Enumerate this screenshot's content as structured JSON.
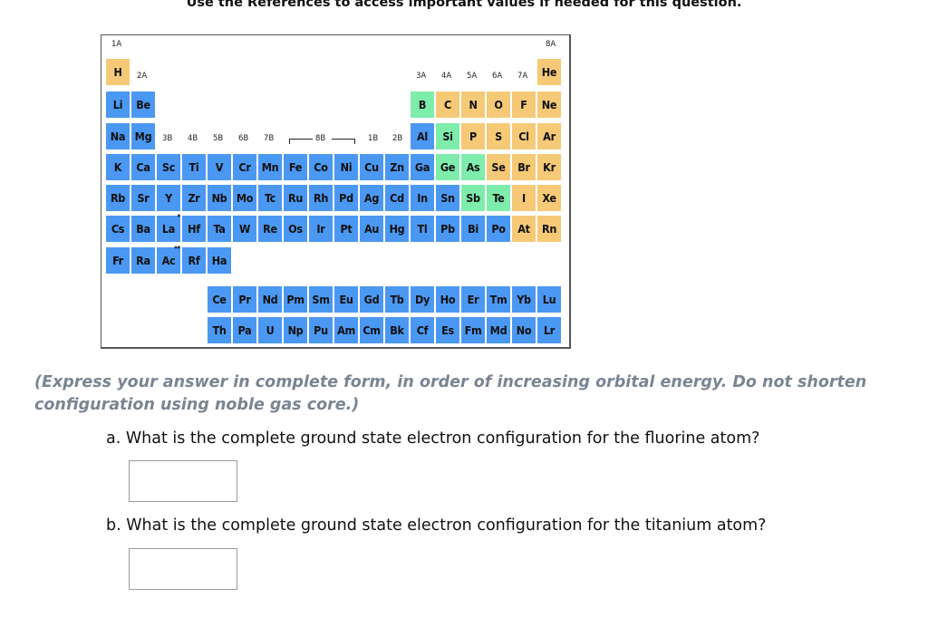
{
  "reference_note": "Use the References to access important values if needed for this question.",
  "periodic_table": {
    "group_labels": {
      "1A": "1A",
      "2A": "2A",
      "3A": "3A",
      "4A": "4A",
      "5A": "5A",
      "6A": "6A",
      "7A": "7A",
      "8A": "8A",
      "3B": "3B",
      "4B": "4B",
      "5B": "5B",
      "6B": "6B",
      "7B": "7B",
      "8B": "8B",
      "1B": "1B",
      "2B": "2B"
    },
    "colors": {
      "metal": "#4b98f2",
      "nonmetal": "#f5c976",
      "metalloid": "#7eecab"
    },
    "elements": [
      {
        "symbol": "H",
        "row": 1,
        "col": 1,
        "type": "nonmetal"
      },
      {
        "symbol": "He",
        "row": 1,
        "col": 18,
        "type": "nonmetal"
      },
      {
        "symbol": "Li",
        "row": 2,
        "col": 1,
        "type": "metal"
      },
      {
        "symbol": "Be",
        "row": 2,
        "col": 2,
        "type": "metal"
      },
      {
        "symbol": "B",
        "row": 2,
        "col": 13,
        "type": "metalloid"
      },
      {
        "symbol": "C",
        "row": 2,
        "col": 14,
        "type": "nonmetal"
      },
      {
        "symbol": "N",
        "row": 2,
        "col": 15,
        "type": "nonmetal"
      },
      {
        "symbol": "O",
        "row": 2,
        "col": 16,
        "type": "nonmetal"
      },
      {
        "symbol": "F",
        "row": 2,
        "col": 17,
        "type": "nonmetal"
      },
      {
        "symbol": "Ne",
        "row": 2,
        "col": 18,
        "type": "nonmetal"
      },
      {
        "symbol": "Na",
        "row": 3,
        "col": 1,
        "type": "metal"
      },
      {
        "symbol": "Mg",
        "row": 3,
        "col": 2,
        "type": "metal"
      },
      {
        "symbol": "Al",
        "row": 3,
        "col": 13,
        "type": "metal"
      },
      {
        "symbol": "Si",
        "row": 3,
        "col": 14,
        "type": "metalloid"
      },
      {
        "symbol": "P",
        "row": 3,
        "col": 15,
        "type": "nonmetal"
      },
      {
        "symbol": "S",
        "row": 3,
        "col": 16,
        "type": "nonmetal"
      },
      {
        "symbol": "Cl",
        "row": 3,
        "col": 17,
        "type": "nonmetal"
      },
      {
        "symbol": "Ar",
        "row": 3,
        "col": 18,
        "type": "nonmetal"
      },
      {
        "symbol": "K",
        "row": 4,
        "col": 1,
        "type": "metal"
      },
      {
        "symbol": "Ca",
        "row": 4,
        "col": 2,
        "type": "metal"
      },
      {
        "symbol": "Sc",
        "row": 4,
        "col": 3,
        "type": "metal"
      },
      {
        "symbol": "Ti",
        "row": 4,
        "col": 4,
        "type": "metal"
      },
      {
        "symbol": "V",
        "row": 4,
        "col": 5,
        "type": "metal"
      },
      {
        "symbol": "Cr",
        "row": 4,
        "col": 6,
        "type": "metal"
      },
      {
        "symbol": "Mn",
        "row": 4,
        "col": 7,
        "type": "metal"
      },
      {
        "symbol": "Fe",
        "row": 4,
        "col": 8,
        "type": "metal"
      },
      {
        "symbol": "Co",
        "row": 4,
        "col": 9,
        "type": "metal"
      },
      {
        "symbol": "Ni",
        "row": 4,
        "col": 10,
        "type": "metal"
      },
      {
        "symbol": "Cu",
        "row": 4,
        "col": 11,
        "type": "metal"
      },
      {
        "symbol": "Zn",
        "row": 4,
        "col": 12,
        "type": "metal"
      },
      {
        "symbol": "Ga",
        "row": 4,
        "col": 13,
        "type": "metal"
      },
      {
        "symbol": "Ge",
        "row": 4,
        "col": 14,
        "type": "metalloid"
      },
      {
        "symbol": "As",
        "row": 4,
        "col": 15,
        "type": "metalloid"
      },
      {
        "symbol": "Se",
        "row": 4,
        "col": 16,
        "type": "nonmetal"
      },
      {
        "symbol": "Br",
        "row": 4,
        "col": 17,
        "type": "nonmetal"
      },
      {
        "symbol": "Kr",
        "row": 4,
        "col": 18,
        "type": "nonmetal"
      },
      {
        "symbol": "Rb",
        "row": 5,
        "col": 1,
        "type": "metal"
      },
      {
        "symbol": "Sr",
        "row": 5,
        "col": 2,
        "type": "metal"
      },
      {
        "symbol": "Y",
        "row": 5,
        "col": 3,
        "type": "metal"
      },
      {
        "symbol": "Zr",
        "row": 5,
        "col": 4,
        "type": "metal"
      },
      {
        "symbol": "Nb",
        "row": 5,
        "col": 5,
        "type": "metal"
      },
      {
        "symbol": "Mo",
        "row": 5,
        "col": 6,
        "type": "metal"
      },
      {
        "symbol": "Tc",
        "row": 5,
        "col": 7,
        "type": "metal"
      },
      {
        "symbol": "Ru",
        "row": 5,
        "col": 8,
        "type": "metal"
      },
      {
        "symbol": "Rh",
        "row": 5,
        "col": 9,
        "type": "metal"
      },
      {
        "symbol": "Pd",
        "row": 5,
        "col": 10,
        "type": "metal"
      },
      {
        "symbol": "Ag",
        "row": 5,
        "col": 11,
        "type": "metal"
      },
      {
        "symbol": "Cd",
        "row": 5,
        "col": 12,
        "type": "metal"
      },
      {
        "symbol": "In",
        "row": 5,
        "col": 13,
        "type": "metal"
      },
      {
        "symbol": "Sn",
        "row": 5,
        "col": 14,
        "type": "metal"
      },
      {
        "symbol": "Sb",
        "row": 5,
        "col": 15,
        "type": "metalloid"
      },
      {
        "symbol": "Te",
        "row": 5,
        "col": 16,
        "type": "metalloid"
      },
      {
        "symbol": "I",
        "row": 5,
        "col": 17,
        "type": "nonmetal"
      },
      {
        "symbol": "Xe",
        "row": 5,
        "col": 18,
        "type": "nonmetal"
      },
      {
        "symbol": "Cs",
        "row": 6,
        "col": 1,
        "type": "metal"
      },
      {
        "symbol": "Ba",
        "row": 6,
        "col": 2,
        "type": "metal"
      },
      {
        "symbol": "La",
        "row": 6,
        "col": 3,
        "type": "metal",
        "mark": "*"
      },
      {
        "symbol": "Hf",
        "row": 6,
        "col": 4,
        "type": "metal"
      },
      {
        "symbol": "Ta",
        "row": 6,
        "col": 5,
        "type": "metal"
      },
      {
        "symbol": "W",
        "row": 6,
        "col": 6,
        "type": "metal"
      },
      {
        "symbol": "Re",
        "row": 6,
        "col": 7,
        "type": "metal"
      },
      {
        "symbol": "Os",
        "row": 6,
        "col": 8,
        "type": "metal"
      },
      {
        "symbol": "Ir",
        "row": 6,
        "col": 9,
        "type": "metal"
      },
      {
        "symbol": "Pt",
        "row": 6,
        "col": 10,
        "type": "metal"
      },
      {
        "symbol": "Au",
        "row": 6,
        "col": 11,
        "type": "metal"
      },
      {
        "symbol": "Hg",
        "row": 6,
        "col": 12,
        "type": "metal"
      },
      {
        "symbol": "Tl",
        "row": 6,
        "col": 13,
        "type": "metal"
      },
      {
        "symbol": "Pb",
        "row": 6,
        "col": 14,
        "type": "metal"
      },
      {
        "symbol": "Bi",
        "row": 6,
        "col": 15,
        "type": "metal"
      },
      {
        "symbol": "Po",
        "row": 6,
        "col": 16,
        "type": "metal"
      },
      {
        "symbol": "At",
        "row": 6,
        "col": 17,
        "type": "nonmetal"
      },
      {
        "symbol": "Rn",
        "row": 6,
        "col": 18,
        "type": "nonmetal"
      },
      {
        "symbol": "Fr",
        "row": 7,
        "col": 1,
        "type": "metal"
      },
      {
        "symbol": "Ra",
        "row": 7,
        "col": 2,
        "type": "metal"
      },
      {
        "symbol": "Ac",
        "row": 7,
        "col": 3,
        "type": "metal",
        "mark": "**"
      },
      {
        "symbol": "Rf",
        "row": 7,
        "col": 4,
        "type": "metal"
      },
      {
        "symbol": "Ha",
        "row": 7,
        "col": 5,
        "type": "metal"
      },
      {
        "symbol": "Ce",
        "row": 8,
        "col": 5,
        "type": "metal"
      },
      {
        "symbol": "Pr",
        "row": 8,
        "col": 6,
        "type": "metal"
      },
      {
        "symbol": "Nd",
        "row": 8,
        "col": 7,
        "type": "metal"
      },
      {
        "symbol": "Pm",
        "row": 8,
        "col": 8,
        "type": "metal"
      },
      {
        "symbol": "Sm",
        "row": 8,
        "col": 9,
        "type": "metal"
      },
      {
        "symbol": "Eu",
        "row": 8,
        "col": 10,
        "type": "metal"
      },
      {
        "symbol": "Gd",
        "row": 8,
        "col": 11,
        "type": "metal"
      },
      {
        "symbol": "Tb",
        "row": 8,
        "col": 12,
        "type": "metal"
      },
      {
        "symbol": "Dy",
        "row": 8,
        "col": 13,
        "type": "metal"
      },
      {
        "symbol": "Ho",
        "row": 8,
        "col": 14,
        "type": "metal"
      },
      {
        "symbol": "Er",
        "row": 8,
        "col": 15,
        "type": "metal"
      },
      {
        "symbol": "Tm",
        "row": 8,
        "col": 16,
        "type": "metal"
      },
      {
        "symbol": "Yb",
        "row": 8,
        "col": 17,
        "type": "metal"
      },
      {
        "symbol": "Lu",
        "row": 8,
        "col": 18,
        "type": "metal"
      },
      {
        "symbol": "Th",
        "row": 9,
        "col": 5,
        "type": "metal"
      },
      {
        "symbol": "Pa",
        "row": 9,
        "col": 6,
        "type": "metal"
      },
      {
        "symbol": "U",
        "row": 9,
        "col": 7,
        "type": "metal"
      },
      {
        "symbol": "Np",
        "row": 9,
        "col": 8,
        "type": "metal"
      },
      {
        "symbol": "Pu",
        "row": 9,
        "col": 9,
        "type": "metal"
      },
      {
        "symbol": "Am",
        "row": 9,
        "col": 10,
        "type": "metal"
      },
      {
        "symbol": "Cm",
        "row": 9,
        "col": 11,
        "type": "metal"
      },
      {
        "symbol": "Bk",
        "row": 9,
        "col": 12,
        "type": "metal"
      },
      {
        "symbol": "Cf",
        "row": 9,
        "col": 13,
        "type": "metal"
      },
      {
        "symbol": "Es",
        "row": 9,
        "col": 14,
        "type": "metal"
      },
      {
        "symbol": "Fm",
        "row": 9,
        "col": 15,
        "type": "metal"
      },
      {
        "symbol": "Md",
        "row": 9,
        "col": 16,
        "type": "metal"
      },
      {
        "symbol": "No",
        "row": 9,
        "col": 17,
        "type": "metal"
      },
      {
        "symbol": "Lr",
        "row": 9,
        "col": 18,
        "type": "metal"
      }
    ]
  },
  "instructions": "(Express your answer in complete form, in order of increasing orbital energy. Do not shorten configuration using noble gas core.)",
  "questions": [
    {
      "label": "a. What is the complete ground state electron configuration for the fluorine atom?",
      "answer_value": ""
    },
    {
      "label": "b. What is the complete ground state electron configuration for the titanium atom?",
      "answer_value": ""
    }
  ]
}
